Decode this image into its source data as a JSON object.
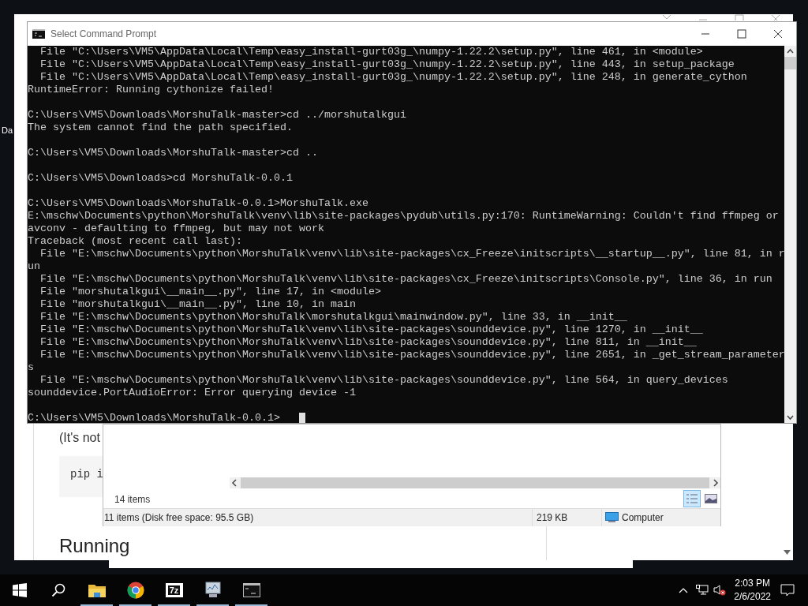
{
  "desktop": {
    "icon_label": "Da"
  },
  "browser": {
    "paragraph": "(It's not",
    "code": "pip i",
    "heading": "Running"
  },
  "explorer": {
    "items_count": "14 items",
    "status_left": "11 items (Disk free space: 95.5 GB)",
    "status_size": "219 KB",
    "status_location": "Computer"
  },
  "terminal": {
    "title": "Select Command Prompt",
    "blocks": [
      [
        "  File \"C:\\Users\\VM5\\AppData\\Local\\Temp\\easy_install-gurt03g_\\numpy-1.22.2\\setup.py\", line 461, in <module>",
        "  File \"C:\\Users\\VM5\\AppData\\Local\\Temp\\easy_install-gurt03g_\\numpy-1.22.2\\setup.py\", line 443, in setup_package",
        "  File \"C:\\Users\\VM5\\AppData\\Local\\Temp\\easy_install-gurt03g_\\numpy-1.22.2\\setup.py\", line 248, in generate_cython",
        "RuntimeError: Running cythonize failed!"
      ],
      [
        "C:\\Users\\VM5\\Downloads\\MorshuTalk-master>cd ../morshutalkgui",
        "The system cannot find the path specified."
      ],
      [
        "C:\\Users\\VM5\\Downloads\\MorshuTalk-master>cd .."
      ],
      [
        "C:\\Users\\VM5\\Downloads>cd MorshuTalk-0.0.1"
      ],
      [
        "C:\\Users\\VM5\\Downloads\\MorshuTalk-0.0.1>MorshuTalk.exe",
        "E:\\mschw\\Documents\\python\\MorshuTalk\\venv\\lib\\site-packages\\pydub\\utils.py:170: RuntimeWarning: Couldn't find ffmpeg or",
        "avconv - defaulting to ffmpeg, but may not work",
        "Traceback (most recent call last):",
        "  File \"E:\\mschw\\Documents\\python\\MorshuTalk\\venv\\lib\\site-packages\\cx_Freeze\\initscripts\\__startup__.py\", line 81, in r",
        "un",
        "  File \"E:\\mschw\\Documents\\python\\MorshuTalk\\venv\\lib\\site-packages\\cx_Freeze\\initscripts\\Console.py\", line 36, in run",
        "  File \"morshutalkgui\\__main__.py\", line 17, in <module>",
        "  File \"morshutalkgui\\__main__.py\", line 10, in main",
        "  File \"E:\\mschw\\Documents\\python\\MorshuTalk\\morshutalkgui\\mainwindow.py\", line 33, in __init__",
        "  File \"E:\\mschw\\Documents\\python\\MorshuTalk\\venv\\lib\\site-packages\\sounddevice.py\", line 1270, in __init__",
        "  File \"E:\\mschw\\Documents\\python\\MorshuTalk\\venv\\lib\\site-packages\\sounddevice.py\", line 811, in __init__",
        "  File \"E:\\mschw\\Documents\\python\\MorshuTalk\\venv\\lib\\site-packages\\sounddevice.py\", line 2651, in _get_stream_parameter",
        "s",
        "  File \"E:\\mschw\\Documents\\python\\MorshuTalk\\venv\\lib\\site-packages\\sounddevice.py\", line 564, in query_devices",
        "sounddevice.PortAudioError: Error querying device -1"
      ],
      [
        "C:\\Users\\VM5\\Downloads\\MorshuTalk-0.0.1>"
      ]
    ]
  },
  "taskbar": {
    "items": [
      {
        "kind": "start",
        "running": false
      },
      {
        "kind": "search",
        "running": false
      },
      {
        "kind": "folder",
        "running": true
      },
      {
        "kind": "chrome",
        "running": true
      },
      {
        "kind": "sevenzip",
        "label": "7z",
        "running": true
      },
      {
        "kind": "monitor",
        "running": true
      },
      {
        "kind": "terminal",
        "running": true
      }
    ],
    "time": "2:03 PM",
    "date": "2/6/2022"
  }
}
